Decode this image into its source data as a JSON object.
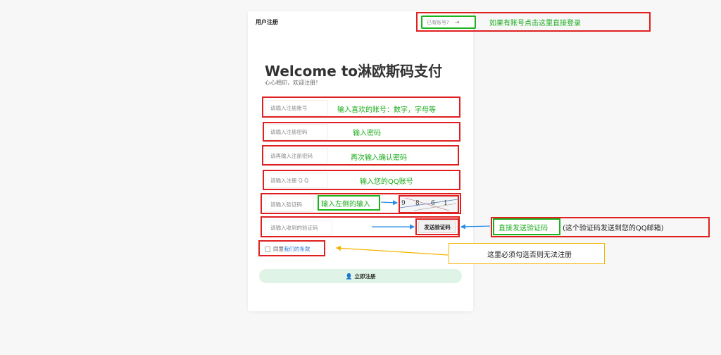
{
  "card": {
    "title": "用户注册",
    "login_pill": "已有账号?",
    "welcome": "Welcome to淋欧斯码支付",
    "subtitle": "心心相印，欢迎注册！"
  },
  "fields": {
    "account_placeholder": "请输入注册账号",
    "password_placeholder": "请输入注册密码",
    "confirm_placeholder": "请再输入注册密码",
    "qq_placeholder": "请输入注册 Q Q",
    "captcha_placeholder": "请输入验证码",
    "code_placeholder": "请输入收到的验证码"
  },
  "captcha_digits": [
    "9",
    "8",
    "6",
    "1"
  ],
  "send_code_label": "发送验证码",
  "agree": {
    "prefix": "同意",
    "link": "我们的条款"
  },
  "register_label": "立即注册",
  "annotations": {
    "login_tip": "如果有账号点击这里直接登录",
    "account_tip": "输入喜欢的账号：数字，字母等",
    "password_tip": "输入密码",
    "confirm_tip": "再次输入确认密码",
    "qq_tip": "输入您的QQ账号",
    "captcha_tip": "输入左侧的输入",
    "send_tip": "直接发送验证码",
    "send_note": "(这个验证码发送到您的QQ邮箱)",
    "agree_tip": "这里必须勾选否则无法注册"
  },
  "colors": {
    "red": "#e02020",
    "green": "#1bb31b",
    "yellow": "#f5b400",
    "blue_arrow": "#2a8ee8"
  }
}
